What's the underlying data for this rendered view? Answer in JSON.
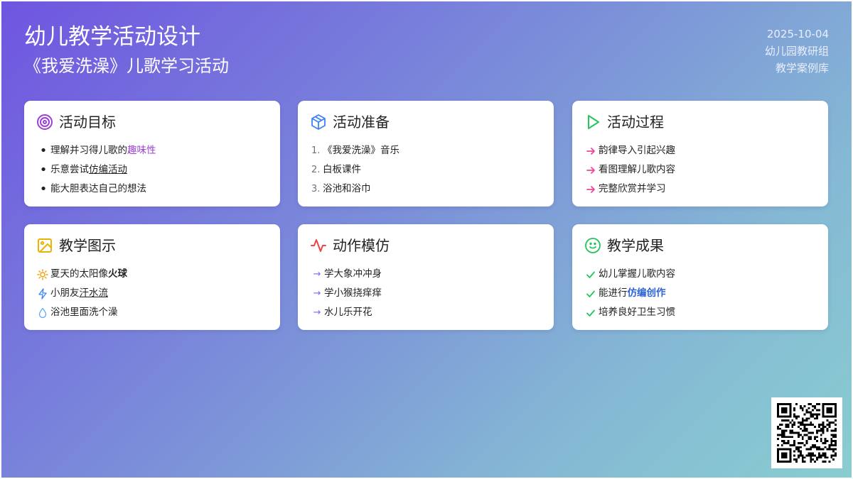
{
  "header": {
    "title": "幼儿教学活动设计",
    "subtitle": "《我爱洗澡》儿歌学习活动",
    "date": "2025-10-04",
    "group": "幼儿园教研组",
    "library": "教学案例库"
  },
  "cards": {
    "goals": {
      "title": "活动目标",
      "icon": "target-icon",
      "items": [
        {
          "pre": "理解并习得儿歌的",
          "hl": "趣味性"
        },
        {
          "pre": "乐意尝试",
          "hl": "仿编活动"
        },
        {
          "pre": "能大胆表达自己的想法"
        }
      ]
    },
    "prep": {
      "title": "活动准备",
      "icon": "cube-icon",
      "items": [
        {
          "num": "1.",
          "text": "《我爱洗澡》音乐"
        },
        {
          "num": "2.",
          "text": "白板课件"
        },
        {
          "num": "3.",
          "text": "浴池和浴巾"
        }
      ]
    },
    "process": {
      "title": "活动过程",
      "icon": "play-icon",
      "items": [
        {
          "text": "韵律导入引起兴趣"
        },
        {
          "text": "看图理解儿歌内容"
        },
        {
          "text": "完整欣赏并学习"
        }
      ]
    },
    "illustration": {
      "title": "教学图示",
      "icon": "image-icon",
      "items": [
        {
          "icon": "sun-icon",
          "pre": "夏天的太阳像",
          "hl": "火球"
        },
        {
          "icon": "lightning-icon",
          "pre": "小朋友",
          "hl": "汗水流"
        },
        {
          "icon": "droplet-icon",
          "pre": "浴池里面洗个澡"
        }
      ]
    },
    "actions": {
      "title": "动作模仿",
      "icon": "activity-icon",
      "items": [
        {
          "text": "学大象冲冲身"
        },
        {
          "text": "学小猴挠痒痒"
        },
        {
          "text": "水儿乐开花"
        }
      ]
    },
    "results": {
      "title": "教学成果",
      "icon": "smile-icon",
      "items": [
        {
          "pre": "幼儿掌握儿歌内容"
        },
        {
          "pre": "能进行",
          "hl": "仿编创作"
        },
        {
          "pre": "培养良好卫生习惯"
        }
      ]
    }
  },
  "colors": {
    "goals": "#9b3fd6",
    "prep": "#3b82f6",
    "process": "#22c55e",
    "process_arrow": "#ec4899",
    "illustration": "#eab308",
    "actions": "#ef4444",
    "actions_arrow": "#8b5cf6",
    "results": "#22c55e",
    "results_highlight": "#2b62d9"
  },
  "qr": {
    "icon": "qr-code-icon"
  }
}
